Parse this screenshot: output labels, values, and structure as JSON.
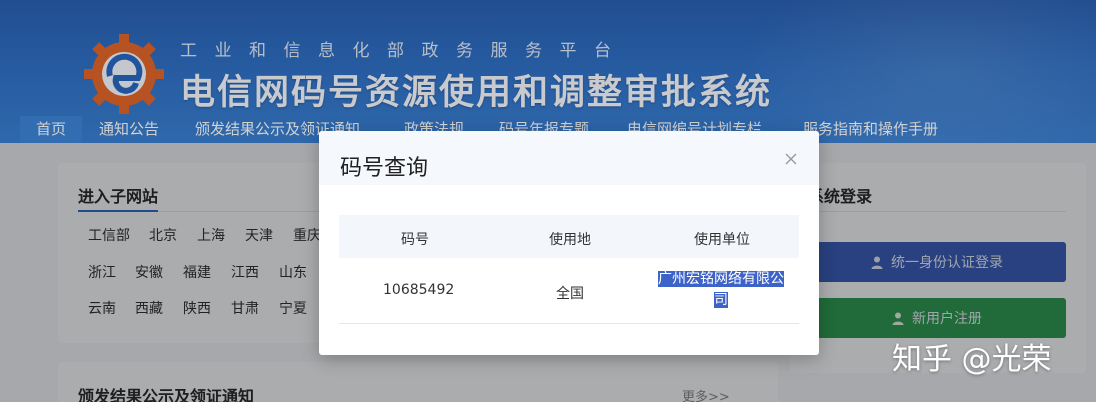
{
  "header": {
    "ministry": "工业和信息化部政务服务平台",
    "system_title": "电信网码号资源使用和调整审批系统"
  },
  "nav": {
    "items": [
      {
        "label": "首页",
        "active": true
      },
      {
        "label": "通知公告"
      },
      {
        "label": "颁发结果公示及领证通知"
      },
      {
        "label": "政策法规"
      },
      {
        "label": "码号年报专题"
      },
      {
        "label": "电信网编号计划专栏"
      },
      {
        "label": "服务指南和操作手册"
      }
    ]
  },
  "subsites": {
    "title": "进入子网站",
    "rows": [
      [
        "工信部",
        "北京",
        "上海",
        "天津",
        "重庆"
      ],
      [
        "浙江",
        "安徽",
        "福建",
        "江西",
        "山东"
      ],
      [
        "云南",
        "西藏",
        "陕西",
        "甘肃",
        "宁夏"
      ]
    ]
  },
  "login": {
    "title": "系统登录",
    "unified_button": "统一身份认证登录",
    "register_button": "新用户注册"
  },
  "publications": {
    "title": "颁发结果公示及领证通知",
    "more": "更多>>"
  },
  "modal": {
    "title": "码号查询",
    "columns": [
      "码号",
      "使用地",
      "使用单位"
    ],
    "rows": [
      {
        "number": "10685492",
        "location": "全国",
        "unit_line1": "广州宏铭网络有限公",
        "unit_line2": "司"
      }
    ]
  },
  "watermark": "知乎 @光荣",
  "colors": {
    "banner_blue": "#2f6fc4",
    "login_blue": "#3b5db8",
    "register_green": "#2f9a52",
    "selection_highlight": "#3d63c9"
  }
}
